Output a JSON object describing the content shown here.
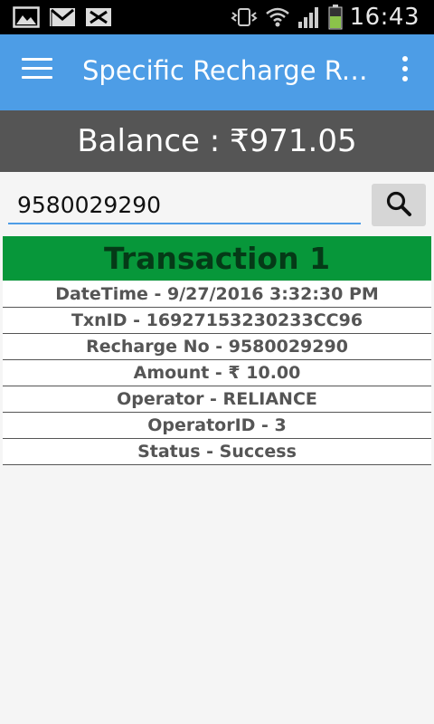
{
  "status_bar": {
    "time": "16:43",
    "left_icons": [
      "gallery-icon",
      "gmail-icon",
      "missed-notification-icon"
    ],
    "right_icons": [
      "vibrate-icon",
      "wifi-icon",
      "signal-icon",
      "battery-icon"
    ]
  },
  "app_bar": {
    "title": "Specific Recharge Rep..."
  },
  "balance": {
    "text": "Balance : ₹971.05"
  },
  "search": {
    "value": "9580029290"
  },
  "transaction": {
    "title": "Transaction 1",
    "rows": [
      "DateTime - 9/27/2016 3:32:30 PM",
      "TxnID - 16927153230233CC96",
      "Recharge No - 9580029290",
      "Amount - ₹ 10.00",
      "Operator - RELIANCE",
      "OperatorID - 3",
      "Status - Success"
    ]
  },
  "colors": {
    "app_bar": "#4d9de6",
    "balance_bar": "#555555",
    "transaction_header": "#07973a"
  }
}
